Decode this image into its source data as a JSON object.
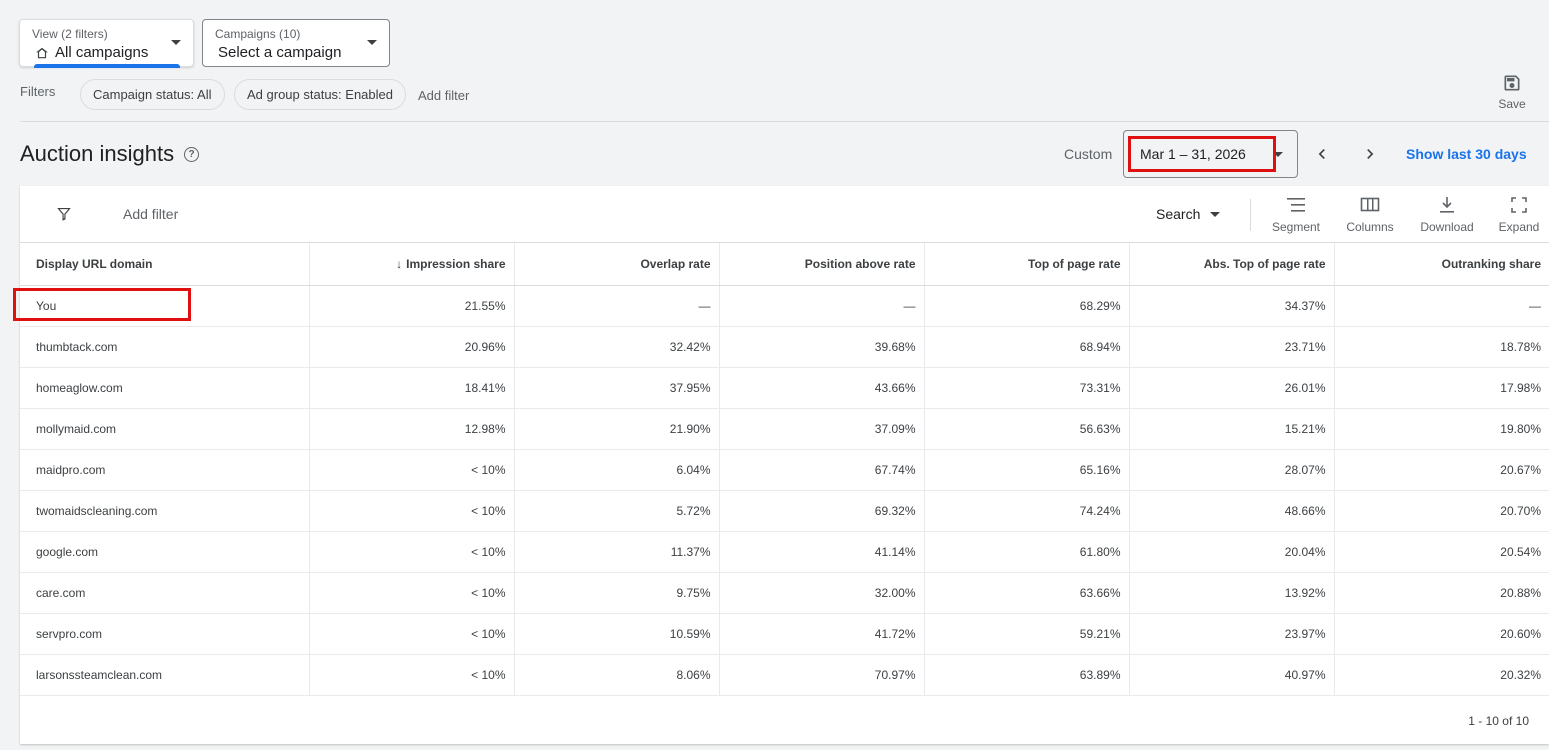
{
  "view_dropdown": {
    "small_label": "View (2 filters)",
    "value": "All campaigns",
    "icon": "home-icon"
  },
  "campaign_dropdown": {
    "small_label": "Campaigns (10)",
    "value": "Select a campaign"
  },
  "filters": {
    "label": "Filters",
    "chips": [
      "Campaign status: All",
      "Ad group status: Enabled"
    ],
    "add_filter": "Add filter"
  },
  "save": {
    "label": "Save",
    "icon": "save-icon"
  },
  "page": {
    "title": "Auction insights",
    "help_icon": "?",
    "date_mode": "Custom",
    "date_range": "Mar 1 – 31, 2026",
    "show_last": "Show last 30 days"
  },
  "toolbar": {
    "add_filter": "Add filter",
    "search": "Search",
    "segment": "Segment",
    "columns": "Columns",
    "download": "Download",
    "expand": "Expand"
  },
  "table": {
    "headers": [
      "Display URL domain",
      "Impression share",
      "Overlap rate",
      "Position above rate",
      "Top of page rate",
      "Abs. Top of page rate",
      "Outranking share"
    ],
    "sort_indicator": "↓",
    "rows": [
      [
        "You",
        "21.55%",
        "—",
        "—",
        "68.29%",
        "34.37%",
        "—"
      ],
      [
        "thumbtack.com",
        "20.96%",
        "32.42%",
        "39.68%",
        "68.94%",
        "23.71%",
        "18.78%"
      ],
      [
        "homeaglow.com",
        "18.41%",
        "37.95%",
        "43.66%",
        "73.31%",
        "26.01%",
        "17.98%"
      ],
      [
        "mollymaid.com",
        "12.98%",
        "21.90%",
        "37.09%",
        "56.63%",
        "15.21%",
        "19.80%"
      ],
      [
        "maidpro.com",
        "< 10%",
        "6.04%",
        "67.74%",
        "65.16%",
        "28.07%",
        "20.67%"
      ],
      [
        "twomaidscleaning.com",
        "< 10%",
        "5.72%",
        "69.32%",
        "74.24%",
        "48.66%",
        "20.70%"
      ],
      [
        "google.com",
        "< 10%",
        "11.37%",
        "41.14%",
        "61.80%",
        "20.04%",
        "20.54%"
      ],
      [
        "care.com",
        "< 10%",
        "9.75%",
        "32.00%",
        "63.66%",
        "13.92%",
        "20.88%"
      ],
      [
        "servpro.com",
        "< 10%",
        "10.59%",
        "41.72%",
        "59.21%",
        "23.97%",
        "20.60%"
      ],
      [
        "larsonssteamclean.com",
        "< 10%",
        "8.06%",
        "70.97%",
        "63.89%",
        "40.97%",
        "20.32%"
      ]
    ],
    "pagination": "1 - 10 of 10"
  },
  "colors": {
    "accent": "#1a73e8",
    "highlight": "#e01010",
    "background": "#f1f3f4"
  }
}
